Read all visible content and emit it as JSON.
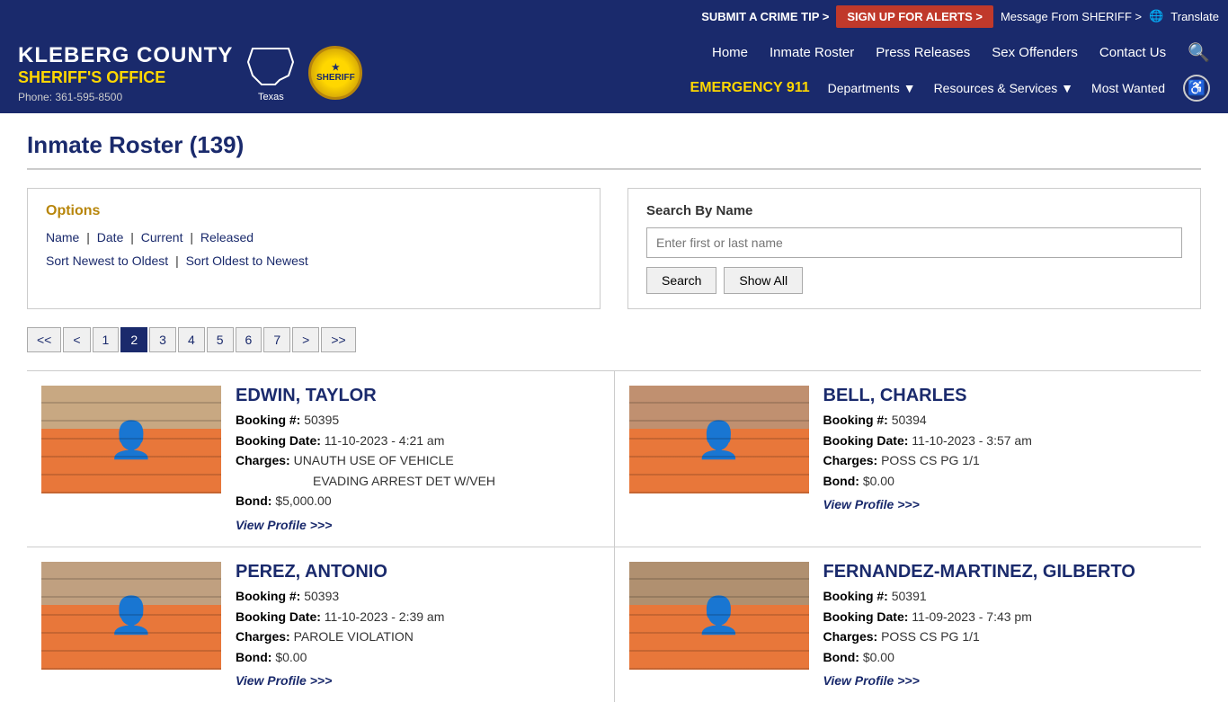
{
  "topbar": {
    "crime_tip": "SUBMIT A CRIME TIP >",
    "alerts": "SIGN UP FOR ALERTS >",
    "message": "Message From SHERIFF >",
    "translate": "Translate"
  },
  "header": {
    "county": "KLEBERG COUNTY",
    "office": "SHERIFF'S OFFICE",
    "phone_label": "Phone:",
    "phone": "361-595-8500",
    "texas_label": "Texas",
    "nav": {
      "home": "Home",
      "inmate_roster": "Inmate Roster",
      "press_releases": "Press Releases",
      "sex_offenders": "Sex Offenders",
      "contact_us": "Contact Us"
    },
    "emergency": "EMERGENCY",
    "emergency_num": "911",
    "departments": "Departments",
    "resources": "Resources & Services",
    "most_wanted": "Most Wanted"
  },
  "page": {
    "title": "Inmate Roster (139)"
  },
  "options": {
    "title": "Options",
    "links": [
      "Name",
      "Date",
      "Current",
      "Released"
    ],
    "sort_links": [
      "Sort Newest to Oldest",
      "Sort Oldest to Newest"
    ]
  },
  "search": {
    "label": "Search By Name",
    "placeholder": "Enter first or last name",
    "search_btn": "Search",
    "show_all_btn": "Show All"
  },
  "pagination": {
    "pages": [
      "<<",
      "<",
      "1",
      "2",
      "3",
      "4",
      "5",
      "6",
      "7",
      ">",
      ">>"
    ],
    "active": "2"
  },
  "inmates": [
    {
      "name": "EDWIN, TAYLOR",
      "booking_num": "50395",
      "booking_date": "11-10-2023 - 4:21 am",
      "charges": [
        "UNAUTH USE OF VEHICLE",
        "EVADING ARREST DET W/VEH"
      ],
      "bond": "$5,000.00",
      "profile_link": "View Profile >>>",
      "photo_class": "mugshot-1"
    },
    {
      "name": "BELL, CHARLES",
      "booking_num": "50394",
      "booking_date": "11-10-2023 - 3:57 am",
      "charges": [
        "POSS CS PG 1/1"
      ],
      "bond": "$0.00",
      "profile_link": "View Profile >>>",
      "photo_class": "mugshot-2"
    },
    {
      "name": "PEREZ, ANTONIO",
      "booking_num": "50393",
      "booking_date": "11-10-2023 - 2:39 am",
      "charges": [
        "PAROLE VIOLATION"
      ],
      "bond": "$0.00",
      "profile_link": "View Profile >>>",
      "photo_class": "mugshot-3"
    },
    {
      "name": "FERNANDEZ-MARTINEZ, GILBERTO",
      "booking_num": "50391",
      "booking_date": "11-09-2023 - 7:43 pm",
      "charges": [
        "POSS CS PG 1/1"
      ],
      "bond": "$0.00",
      "profile_link": "View Profile >>>",
      "photo_class": "mugshot-4"
    }
  ],
  "labels": {
    "booking_num": "Booking #:",
    "booking_date": "Booking Date:",
    "charges": "Charges:",
    "bond": "Bond:"
  }
}
